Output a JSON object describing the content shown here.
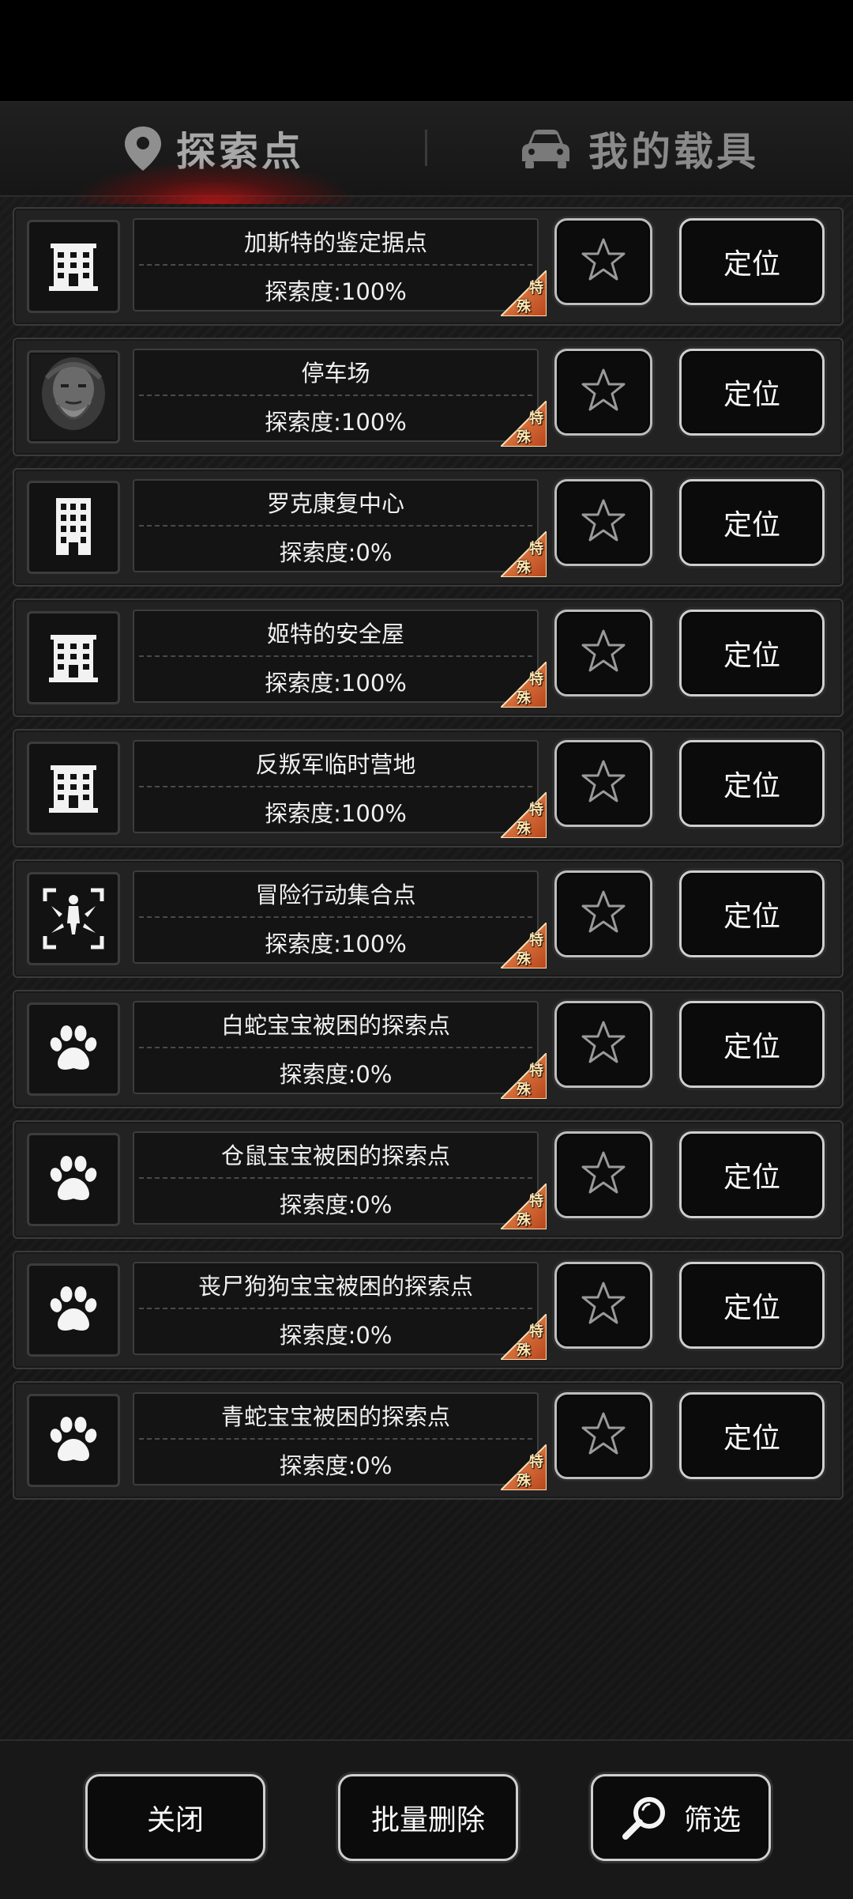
{
  "tabs": {
    "explore_label": "探索点",
    "vehicle_label": "我的载具",
    "explore_icon": "location-pin-icon",
    "vehicle_icon": "car-icon"
  },
  "special_badge": {
    "line1": "特",
    "line2": "殊"
  },
  "locations": [
    {
      "name": "加斯特的鉴定据点",
      "progress": "探索度:100%",
      "icon": "building-icon",
      "favorite_icon": "star-outline-icon",
      "locate_label": "定位"
    },
    {
      "name": "停车场",
      "progress": "探索度:100%",
      "icon": "bearded-man-portrait",
      "favorite_icon": "star-outline-icon",
      "locate_label": "定位"
    },
    {
      "name": "罗克康复中心",
      "progress": "探索度:0%",
      "icon": "tall-building-icon",
      "favorite_icon": "star-outline-icon",
      "locate_label": "定位"
    },
    {
      "name": "姬特的安全屋",
      "progress": "探索度:100%",
      "icon": "building-icon",
      "favorite_icon": "star-outline-icon",
      "locate_label": "定位"
    },
    {
      "name": "反叛军临时营地",
      "progress": "探索度:100%",
      "icon": "building-icon",
      "favorite_icon": "star-outline-icon",
      "locate_label": "定位"
    },
    {
      "name": "冒险行动集合点",
      "progress": "探索度:100%",
      "icon": "rally-point-icon",
      "favorite_icon": "star-outline-icon",
      "locate_label": "定位"
    },
    {
      "name": "白蛇宝宝被困的探索点",
      "progress": "探索度:0%",
      "icon": "paw-icon",
      "favorite_icon": "star-outline-icon",
      "locate_label": "定位"
    },
    {
      "name": "仓鼠宝宝被困的探索点",
      "progress": "探索度:0%",
      "icon": "paw-icon",
      "favorite_icon": "star-outline-icon",
      "locate_label": "定位"
    },
    {
      "name": "丧尸狗狗宝宝被困的探索点",
      "progress": "探索度:0%",
      "icon": "paw-icon",
      "favorite_icon": "star-outline-icon",
      "locate_label": "定位"
    },
    {
      "name": "青蛇宝宝被困的探索点",
      "progress": "探索度:0%",
      "icon": "paw-icon",
      "favorite_icon": "star-outline-icon",
      "locate_label": "定位"
    }
  ],
  "bottom": {
    "close_label": "关闭",
    "batch_delete_label": "批量删除",
    "filter_label": "筛选",
    "filter_icon": "magnifier-icon"
  },
  "colors": {
    "tab_glow": "#d01414",
    "badge": "#e0743a",
    "button_border": "#cfcfcf"
  }
}
